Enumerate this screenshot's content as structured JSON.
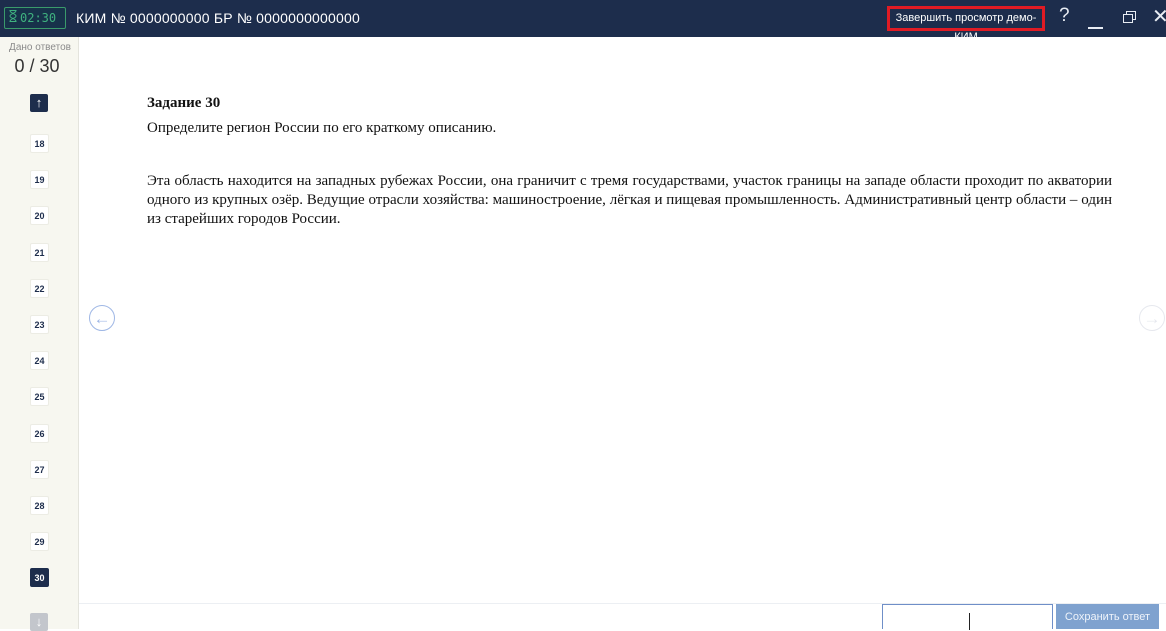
{
  "topbar": {
    "timer": "02:30",
    "kim_title": "КИМ № 0000000000  БР № 0000000000000",
    "finish_label": "Завершить просмотр демо-КИМ",
    "help_glyph": "?",
    "close_glyph": "✕"
  },
  "sidebar": {
    "answers_label": "Дано ответов",
    "answers_count": "0 / 30",
    "up_glyph": "↑",
    "down_glyph": "↓",
    "questions": [
      {
        "n": "18",
        "active": false
      },
      {
        "n": "19",
        "active": false
      },
      {
        "n": "20",
        "active": false
      },
      {
        "n": "21",
        "active": false
      },
      {
        "n": "22",
        "active": false
      },
      {
        "n": "23",
        "active": false
      },
      {
        "n": "24",
        "active": false
      },
      {
        "n": "25",
        "active": false
      },
      {
        "n": "26",
        "active": false
      },
      {
        "n": "27",
        "active": false
      },
      {
        "n": "28",
        "active": false
      },
      {
        "n": "29",
        "active": false
      },
      {
        "n": "30",
        "active": true
      }
    ]
  },
  "nav": {
    "prev_glyph": "←",
    "next_glyph": "→"
  },
  "task": {
    "title": "Задание 30",
    "prompt": "Определите регион России по его краткому описанию.",
    "text": "Эта область находится на западных рубежах России, она граничит с тремя государствами, участок границы на западе области проходит по акватории одного из крупных озёр. Ведущие отрасли хозяйства: машиностроение, лёгкая и пищевая промышленность. Административный центр области – один из старейших городов России."
  },
  "answer": {
    "value": "",
    "save_label": "Сохранить ответ"
  },
  "colors": {
    "topbar": "#1d2d4c",
    "accent_red": "#e01b24",
    "timer_green": "#3fb27f",
    "save_button": "#7fa2cf"
  }
}
